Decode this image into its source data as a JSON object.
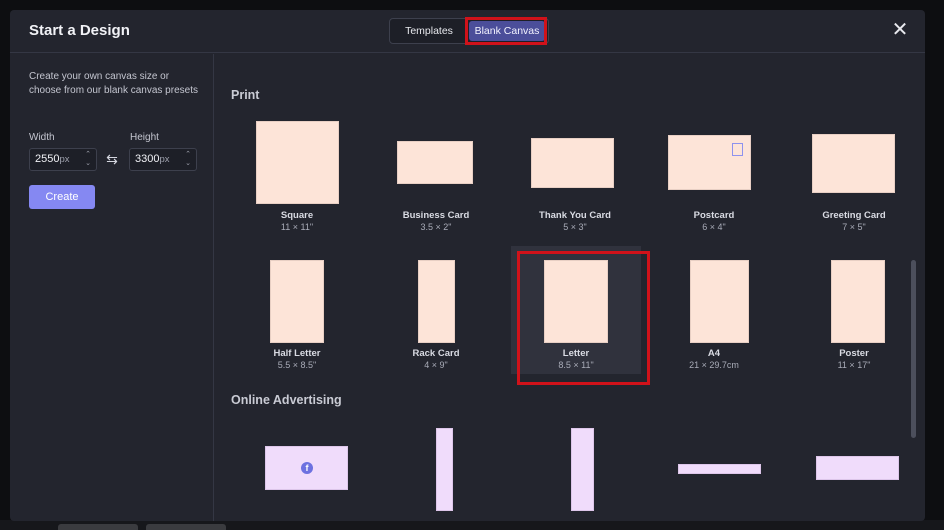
{
  "header": {
    "title": "Start a Design",
    "tabs": {
      "templates": "Templates",
      "blank_canvas": "Blank Canvas"
    },
    "close_icon": "close-icon"
  },
  "left": {
    "description": "Create your own canvas size or choose from our blank canvas presets",
    "width_label": "Width",
    "height_label": "Height",
    "width_value": "2550",
    "height_value": "3300",
    "unit": "px",
    "create_label": "Create",
    "swap_icon": "swap-icon"
  },
  "sections": {
    "print": "Print",
    "online": "Online Advertising"
  },
  "print_cards": [
    {
      "name": "Square",
      "dims": "11 × 11\""
    },
    {
      "name": "Business Card",
      "dims": "3.5 × 2\""
    },
    {
      "name": "Thank You Card",
      "dims": "5 × 3\""
    },
    {
      "name": "Postcard",
      "dims": "6 × 4\""
    },
    {
      "name": "Greeting Card",
      "dims": "7 × 5\""
    },
    {
      "name": "Half Letter",
      "dims": "5.5 × 8.5\""
    },
    {
      "name": "Rack Card",
      "dims": "4 × 9\""
    },
    {
      "name": "Letter",
      "dims": "8.5 × 11\""
    },
    {
      "name": "A4",
      "dims": "21 × 29.7cm"
    },
    {
      "name": "Poster",
      "dims": "11 × 17\""
    }
  ],
  "selected_card": "Letter",
  "colors": {
    "accent": "#8588f2",
    "thumb_print": "#fde4d8",
    "thumb_ad": "#f0dcfb",
    "highlight": "#d0121a"
  }
}
